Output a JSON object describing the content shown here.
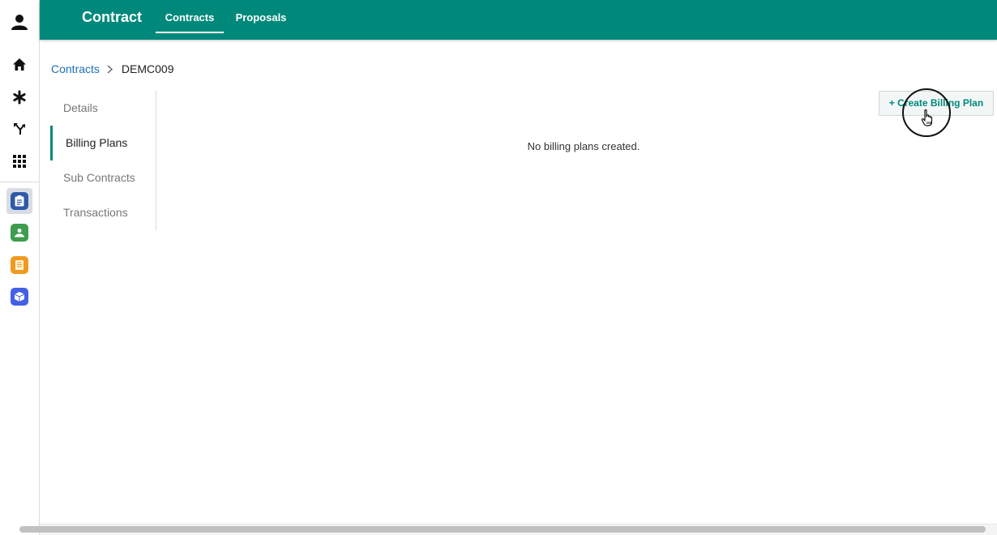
{
  "rail": {
    "top_icons": [
      "user-icon",
      "home-icon",
      "asterisk-icon",
      "branch-icon",
      "apps-grid-icon"
    ],
    "apps": [
      {
        "name": "contracts-app",
        "color": "#2e5aa8",
        "active": true
      },
      {
        "name": "green-app",
        "color": "#3e9b4f",
        "active": false
      },
      {
        "name": "orange-app",
        "color": "#ef9a1f",
        "active": false
      },
      {
        "name": "blue-app",
        "color": "#4460e6",
        "active": false
      }
    ]
  },
  "header": {
    "app_title": "Contract",
    "tabs": [
      {
        "label": "Contracts",
        "active": true
      },
      {
        "label": "Proposals",
        "active": false
      }
    ],
    "accent_color": "#00897b"
  },
  "breadcrumb": {
    "root": "Contracts",
    "current": "DEMC009"
  },
  "sidenav": {
    "items": [
      {
        "label": "Details",
        "active": false
      },
      {
        "label": "Billing Plans",
        "active": true
      },
      {
        "label": "Sub Contracts",
        "active": false
      },
      {
        "label": "Transactions",
        "active": false
      }
    ]
  },
  "main": {
    "empty_message": "No billing plans created.",
    "create_button": "+ Create Billing Plan"
  }
}
